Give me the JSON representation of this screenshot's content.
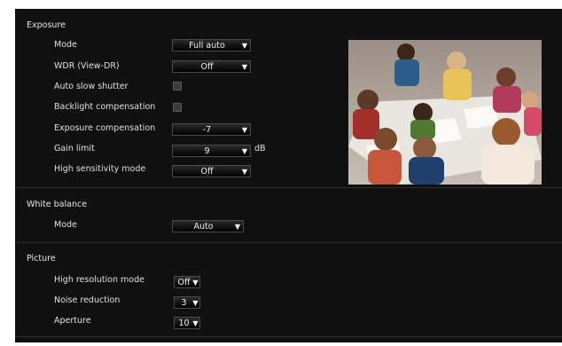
{
  "exposure": {
    "title": "Exposure",
    "rows": {
      "mode": {
        "label": "Mode",
        "value": "Full auto"
      },
      "wdr": {
        "label": "WDR (View-DR)",
        "value": "Off"
      },
      "auto_slow_shutter": {
        "label": "Auto slow shutter"
      },
      "backlight": {
        "label": "Backlight compensation"
      },
      "exposure_comp": {
        "label": "Exposure compensation",
        "value": "-7"
      },
      "gain_limit": {
        "label": "Gain limit",
        "value": "9",
        "unit": "dB"
      },
      "high_sensitivity": {
        "label": "High sensitivity mode",
        "value": "Off"
      }
    }
  },
  "white_balance": {
    "title": "White balance",
    "mode": {
      "label": "Mode",
      "value": "Auto"
    }
  },
  "picture": {
    "title": "Picture",
    "high_resolution": {
      "label": "High resolution mode",
      "value": "Off"
    },
    "noise_reduction": {
      "label": "Noise reduction",
      "value": "3"
    },
    "aperture": {
      "label": "Aperture",
      "value": "10"
    }
  },
  "icons": {
    "dropdown": "triangle-down-icon"
  }
}
